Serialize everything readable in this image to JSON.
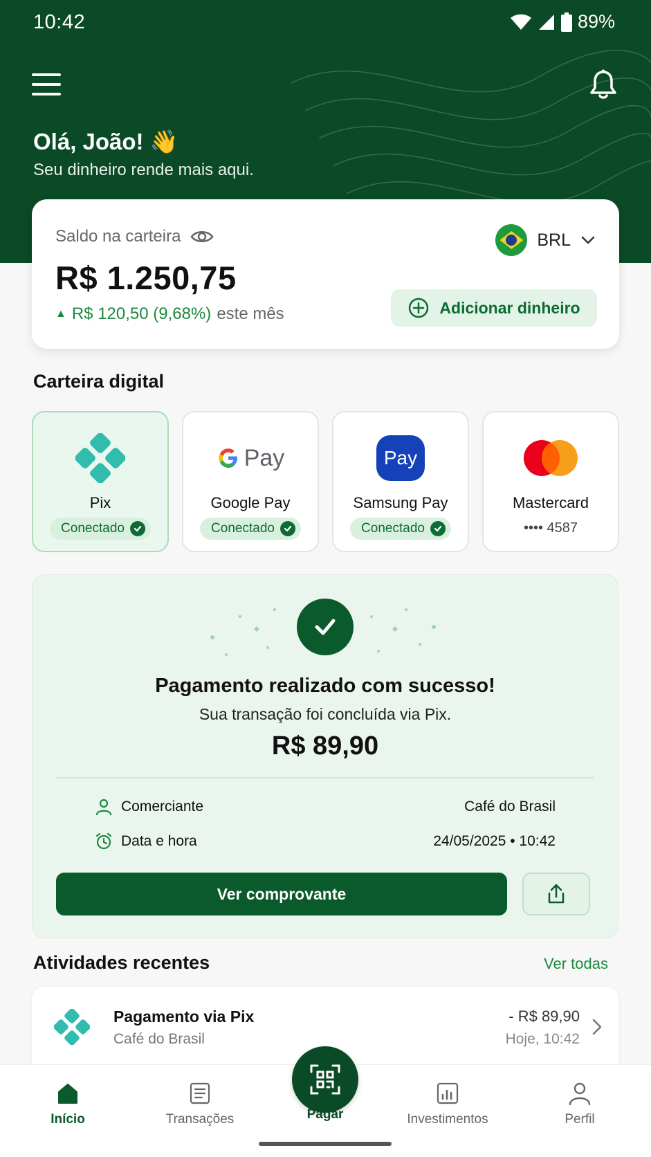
{
  "status_bar": {
    "time": "10:42",
    "battery": "89%"
  },
  "header": {
    "greeting": "Olá, João! 👋",
    "subtitle": "Seu dinheiro rende mais aqui."
  },
  "balance": {
    "label": "Saldo na carteira",
    "amount": "R$ 1.250,75",
    "change_value": "R$ 120,50 (9,68%)",
    "change_suffix": "este mês",
    "currency": "BRL",
    "add_money_label": "Adicionar dinheiro"
  },
  "wallet": {
    "title": "Carteira digital",
    "items": [
      {
        "name": "Pix",
        "status": "Conectado"
      },
      {
        "name": "Google Pay",
        "status": "Conectado",
        "logo_text": "Pay"
      },
      {
        "name": "Samsung Pay",
        "status": "Conectado",
        "logo_text": "Pay"
      },
      {
        "name": "Mastercard",
        "card_number": "•••• 4587"
      }
    ]
  },
  "success": {
    "title": "Pagamento realizado com sucesso!",
    "subtitle": "Sua transação foi concluída via Pix.",
    "amount": "R$ 89,90",
    "merchant_label": "Comerciante",
    "merchant_value": "Café do Brasil",
    "datetime_label": "Data e hora",
    "datetime_value": "24/05/2025 • 10:42",
    "receipt_button": "Ver comprovante"
  },
  "recent": {
    "title": "Atividades recentes",
    "see_all": "Ver todas",
    "items": [
      {
        "title": "Pagamento via Pix",
        "subtitle": "Café do Brasil",
        "amount": "- R$ 89,90",
        "time": "Hoje, 10:42"
      }
    ]
  },
  "nav": {
    "items": [
      "Início",
      "Transações",
      "Pagar",
      "Investimentos",
      "Perfil"
    ]
  },
  "colors": {
    "brand_dark": "#0b4a26",
    "accent_green": "#1b8a3e",
    "pix_teal": "#32bcad"
  }
}
